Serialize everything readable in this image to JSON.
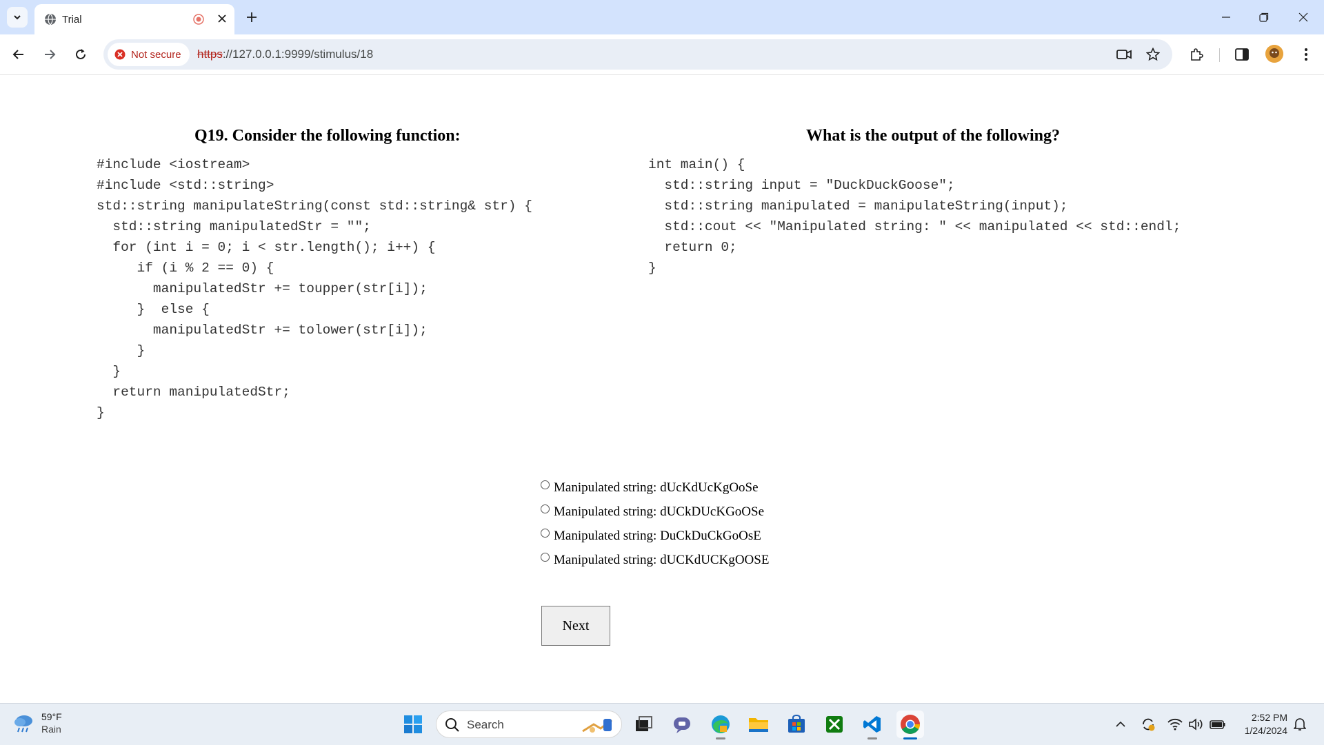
{
  "browser": {
    "tab_title": "Trial",
    "security_label": "Not secure",
    "url_scheme": "https",
    "url_rest": "://127.0.0.1:9999/stimulus/18"
  },
  "question": {
    "left_title": "Q19. Consider the following function:",
    "right_title": "What is the output of the following?",
    "function_code": [
      "#include <iostream>",
      "#include <std::string>",
      "std::string manipulateString(const std::string& str) {",
      "  std::string manipulatedStr = \"\";",
      "  for (int i = 0; i < str.length(); i++) {",
      "     if (i % 2 == 0) {",
      "       manipulatedStr += toupper(str[i]);",
      "     }  else {",
      "       manipulatedStr += tolower(str[i]);",
      "     }",
      "  }",
      "  return manipulatedStr;",
      "}"
    ],
    "main_code": [
      "int main() {",
      "  std::string input = \"DuckDuckGoose\";",
      "  std::string manipulated = manipulateString(input);",
      "  std::cout << \"Manipulated string: \" << manipulated << std::endl;",
      "  return 0;",
      "}"
    ],
    "options": [
      "Manipulated string: dUcKdUcKgOoSe",
      "Manipulated string: dUCkDUcKGoOSe",
      "Manipulated string: DuCkDuCkGoOsE",
      "Manipulated string: dUCKdUCKgOOSE"
    ],
    "next_label": "Next"
  },
  "taskbar": {
    "weather_temp": "59°F",
    "weather_cond": "Rain",
    "search_placeholder": "Search",
    "time": "2:52 PM",
    "date": "1/24/2024"
  }
}
